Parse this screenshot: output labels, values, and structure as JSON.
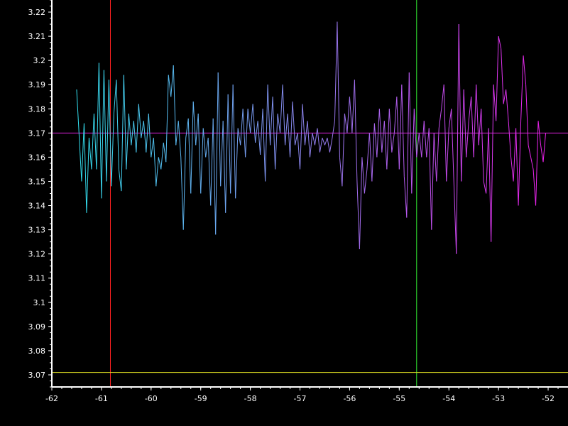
{
  "chart_data": {
    "type": "line",
    "title": "",
    "xlabel": "",
    "ylabel": "",
    "xlim": [
      -62,
      -51.6
    ],
    "ylim": [
      3.065,
      3.225
    ],
    "grid": false,
    "legend": "none",
    "x_ticks": [
      -62,
      -61,
      -60,
      -59,
      -58,
      -57,
      -56,
      -55,
      -54,
      -53,
      -52
    ],
    "x_tick_labels": [
      "-62",
      "-61",
      "-60",
      "-59",
      "-58",
      "-57",
      "-56",
      "-55",
      "-54",
      "-53",
      "-52"
    ],
    "y_ticks": [
      3.07,
      3.08,
      3.09,
      3.1,
      3.11,
      3.12,
      3.13,
      3.14,
      3.15,
      3.16,
      3.17,
      3.18,
      3.19,
      3.2,
      3.21,
      3.22
    ],
    "y_tick_labels": [
      "3.07",
      "3.08",
      "3.09",
      "3.1",
      "3.11",
      "3.12",
      "3.13",
      "3.14",
      "3.15",
      "3.16",
      "3.17",
      "3.18",
      "3.19",
      "3.2",
      "3.21",
      "3.22"
    ],
    "series": [
      {
        "color_start": "#33e0f0",
        "color_end": "#ee22ee",
        "points": [
          [
            -61.5,
            3.188
          ],
          [
            -61.4,
            3.15
          ],
          [
            -61.35,
            3.174
          ],
          [
            -61.3,
            3.137
          ],
          [
            -61.25,
            3.168
          ],
          [
            -61.2,
            3.155
          ],
          [
            -61.15,
            3.178
          ],
          [
            -61.1,
            3.155
          ],
          [
            -61.05,
            3.199
          ],
          [
            -61.0,
            3.143
          ],
          [
            -60.95,
            3.196
          ],
          [
            -60.9,
            3.15
          ],
          [
            -60.85,
            3.192
          ],
          [
            -60.8,
            3.148
          ],
          [
            -60.75,
            3.178
          ],
          [
            -60.7,
            3.192
          ],
          [
            -60.65,
            3.155
          ],
          [
            -60.6,
            3.146
          ],
          [
            -60.55,
            3.194
          ],
          [
            -60.5,
            3.155
          ],
          [
            -60.45,
            3.178
          ],
          [
            -60.4,
            3.165
          ],
          [
            -60.35,
            3.175
          ],
          [
            -60.3,
            3.162
          ],
          [
            -60.25,
            3.182
          ],
          [
            -60.2,
            3.168
          ],
          [
            -60.15,
            3.175
          ],
          [
            -60.1,
            3.162
          ],
          [
            -60.05,
            3.178
          ],
          [
            -60.0,
            3.16
          ],
          [
            -59.95,
            3.168
          ],
          [
            -59.9,
            3.148
          ],
          [
            -59.85,
            3.16
          ],
          [
            -59.8,
            3.155
          ],
          [
            -59.75,
            3.166
          ],
          [
            -59.7,
            3.158
          ],
          [
            -59.65,
            3.194
          ],
          [
            -59.6,
            3.185
          ],
          [
            -59.55,
            3.198
          ],
          [
            -59.5,
            3.165
          ],
          [
            -59.45,
            3.175
          ],
          [
            -59.4,
            3.16
          ],
          [
            -59.35,
            3.13
          ],
          [
            -59.3,
            3.168
          ],
          [
            -59.25,
            3.176
          ],
          [
            -59.2,
            3.145
          ],
          [
            -59.15,
            3.183
          ],
          [
            -59.1,
            3.165
          ],
          [
            -59.05,
            3.178
          ],
          [
            -59.0,
            3.145
          ],
          [
            -58.95,
            3.172
          ],
          [
            -58.9,
            3.16
          ],
          [
            -58.85,
            3.168
          ],
          [
            -58.8,
            3.14
          ],
          [
            -58.75,
            3.176
          ],
          [
            -58.7,
            3.128
          ],
          [
            -58.65,
            3.195
          ],
          [
            -58.6,
            3.148
          ],
          [
            -58.55,
            3.175
          ],
          [
            -58.5,
            3.137
          ],
          [
            -58.45,
            3.186
          ],
          [
            -58.4,
            3.145
          ],
          [
            -58.35,
            3.19
          ],
          [
            -58.3,
            3.143
          ],
          [
            -58.25,
            3.172
          ],
          [
            -58.2,
            3.165
          ],
          [
            -58.15,
            3.18
          ],
          [
            -58.1,
            3.16
          ],
          [
            -58.05,
            3.18
          ],
          [
            -58.0,
            3.17
          ],
          [
            -57.95,
            3.182
          ],
          [
            -57.9,
            3.166
          ],
          [
            -57.85,
            3.175
          ],
          [
            -57.8,
            3.161
          ],
          [
            -57.75,
            3.18
          ],
          [
            -57.7,
            3.15
          ],
          [
            -57.65,
            3.19
          ],
          [
            -57.6,
            3.165
          ],
          [
            -57.55,
            3.185
          ],
          [
            -57.5,
            3.155
          ],
          [
            -57.45,
            3.178
          ],
          [
            -57.4,
            3.17
          ],
          [
            -57.35,
            3.19
          ],
          [
            -57.3,
            3.165
          ],
          [
            -57.25,
            3.178
          ],
          [
            -57.2,
            3.16
          ],
          [
            -57.15,
            3.183
          ],
          [
            -57.1,
            3.165
          ],
          [
            -57.05,
            3.17
          ],
          [
            -57.0,
            3.155
          ],
          [
            -56.95,
            3.182
          ],
          [
            -56.9,
            3.165
          ],
          [
            -56.85,
            3.175
          ],
          [
            -56.8,
            3.16
          ],
          [
            -56.75,
            3.17
          ],
          [
            -56.7,
            3.165
          ],
          [
            -56.65,
            3.172
          ],
          [
            -56.6,
            3.162
          ],
          [
            -56.55,
            3.168
          ],
          [
            -56.5,
            3.165
          ],
          [
            -56.45,
            3.168
          ],
          [
            -56.4,
            3.162
          ],
          [
            -56.35,
            3.168
          ],
          [
            -56.3,
            3.175
          ],
          [
            -56.25,
            3.216
          ],
          [
            -56.2,
            3.16
          ],
          [
            -56.15,
            3.148
          ],
          [
            -56.1,
            3.178
          ],
          [
            -56.05,
            3.17
          ],
          [
            -56.0,
            3.185
          ],
          [
            -55.95,
            3.17
          ],
          [
            -55.9,
            3.192
          ],
          [
            -55.85,
            3.15
          ],
          [
            -55.8,
            3.122
          ],
          [
            -55.75,
            3.16
          ],
          [
            -55.7,
            3.145
          ],
          [
            -55.65,
            3.155
          ],
          [
            -55.6,
            3.17
          ],
          [
            -55.55,
            3.15
          ],
          [
            -55.5,
            3.174
          ],
          [
            -55.45,
            3.16
          ],
          [
            -55.4,
            3.18
          ],
          [
            -55.35,
            3.162
          ],
          [
            -55.3,
            3.175
          ],
          [
            -55.25,
            3.155
          ],
          [
            -55.2,
            3.18
          ],
          [
            -55.15,
            3.162
          ],
          [
            -55.1,
            3.17
          ],
          [
            -55.05,
            3.185
          ],
          [
            -55.0,
            3.155
          ],
          [
            -54.95,
            3.19
          ],
          [
            -54.9,
            3.152
          ],
          [
            -54.85,
            3.135
          ],
          [
            -54.8,
            3.195
          ],
          [
            -54.75,
            3.145
          ],
          [
            -54.7,
            3.18
          ],
          [
            -54.65,
            3.16
          ],
          [
            -54.6,
            3.17
          ],
          [
            -54.55,
            3.16
          ],
          [
            -54.5,
            3.175
          ],
          [
            -54.45,
            3.16
          ],
          [
            -54.4,
            3.172
          ],
          [
            -54.35,
            3.13
          ],
          [
            -54.3,
            3.17
          ],
          [
            -54.25,
            3.15
          ],
          [
            -54.2,
            3.172
          ],
          [
            -54.15,
            3.18
          ],
          [
            -54.1,
            3.19
          ],
          [
            -54.05,
            3.15
          ],
          [
            -54.0,
            3.172
          ],
          [
            -53.95,
            3.18
          ],
          [
            -53.9,
            3.15
          ],
          [
            -53.85,
            3.12
          ],
          [
            -53.8,
            3.215
          ],
          [
            -53.75,
            3.15
          ],
          [
            -53.7,
            3.188
          ],
          [
            -53.65,
            3.16
          ],
          [
            -53.6,
            3.175
          ],
          [
            -53.55,
            3.185
          ],
          [
            -53.5,
            3.16
          ],
          [
            -53.45,
            3.19
          ],
          [
            -53.4,
            3.165
          ],
          [
            -53.35,
            3.18
          ],
          [
            -53.3,
            3.15
          ],
          [
            -53.25,
            3.145
          ],
          [
            -53.2,
            3.172
          ],
          [
            -53.15,
            3.125
          ],
          [
            -53.1,
            3.19
          ],
          [
            -53.05,
            3.175
          ],
          [
            -53.0,
            3.21
          ],
          [
            -52.95,
            3.205
          ],
          [
            -52.9,
            3.182
          ],
          [
            -52.85,
            3.188
          ],
          [
            -52.8,
            3.175
          ],
          [
            -52.75,
            3.16
          ],
          [
            -52.7,
            3.15
          ],
          [
            -52.65,
            3.172
          ],
          [
            -52.6,
            3.14
          ],
          [
            -52.55,
            3.175
          ],
          [
            -52.5,
            3.202
          ],
          [
            -52.45,
            3.19
          ],
          [
            -52.4,
            3.165
          ],
          [
            -52.35,
            3.16
          ],
          [
            -52.3,
            3.155
          ],
          [
            -52.25,
            3.14
          ],
          [
            -52.2,
            3.175
          ],
          [
            -52.15,
            3.165
          ],
          [
            -52.1,
            3.158
          ],
          [
            -52.05,
            3.17
          ]
        ]
      }
    ],
    "reference_lines": [
      {
        "orientation": "vertical",
        "value": -60.82,
        "color": "#ff2020"
      },
      {
        "orientation": "vertical",
        "value": -54.65,
        "color": "#33ee33"
      },
      {
        "orientation": "horizontal",
        "value": 3.17,
        "color": "#dd22dd"
      },
      {
        "orientation": "horizontal",
        "value": 3.071,
        "color": "#dddd22"
      }
    ]
  },
  "colors": {
    "background": "#000000",
    "axis": "#ffffff"
  }
}
